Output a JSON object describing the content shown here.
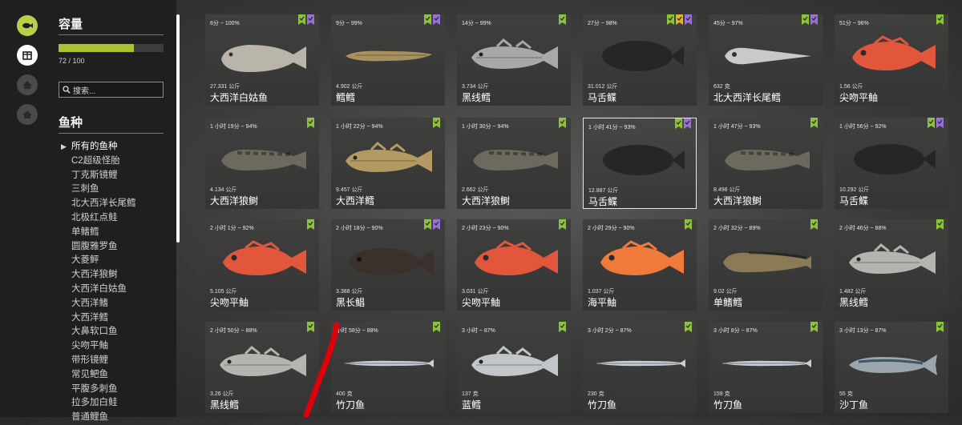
{
  "rail": {
    "icons": [
      "fish-icon",
      "crate-icon",
      "home-icon",
      "home-icon"
    ],
    "accent": "#a9c232"
  },
  "sidebar": {
    "capacity_title": "容量",
    "capacity_value": "72 / 100",
    "capacity_fraction": 0.72,
    "search_placeholder": "搜索...",
    "species_title": "鱼种",
    "species": [
      "所有的鱼种",
      "C2超级怪胎",
      "丁克斯镜鲤",
      "三刺鱼",
      "北大西洋长尾鳕",
      "北极红点鲑",
      "单鳍鳕",
      "圆腹雅罗鱼",
      "大菱鲆",
      "大西洋狼鲥",
      "大西洋白姑鱼",
      "大西洋鳍",
      "大西洋鳕",
      "大鼻软口鱼",
      "尖吻平鲉",
      "带形镜鲤",
      "常见鲃鱼",
      "平腹多刺鱼",
      "拉多加白鲑",
      "普通鲤鱼"
    ]
  },
  "cards": [
    {
      "meta": "6分 ~ 100%",
      "weight": "27.331 公斤",
      "name": "大西洋白姑鱼",
      "badges": [
        "green",
        "purple"
      ],
      "fish": "croaker",
      "color": "#b9b5aa"
    },
    {
      "meta": "9分 ~ 99%",
      "weight": "4.902 公斤",
      "name": "鳕鳕",
      "badges": [
        "green",
        "purple"
      ],
      "fish": "eel",
      "color": "#a8915e"
    },
    {
      "meta": "14分 ~ 99%",
      "weight": "3.734 公斤",
      "name": "黑线鳕",
      "badges": [
        "green"
      ],
      "fish": "cod",
      "color": "#a8a8a6"
    },
    {
      "meta": "27分 ~ 98%",
      "weight": "31.012 公斤",
      "name": "马舌鲽",
      "badges": [
        "green",
        "gold",
        "purple"
      ],
      "fish": "flat",
      "color": "#262626"
    },
    {
      "meta": "45分 ~ 97%",
      "weight": "632 克",
      "name": "北大西洋长尾鳕",
      "badges": [
        "green",
        "purple"
      ],
      "fish": "grenadier",
      "color": "#c9c9cc"
    },
    {
      "meta": "51分 ~ 96%",
      "weight": "1.56 公斤",
      "name": "尖吻平鲉",
      "badges": [
        "green"
      ],
      "fish": "redfish",
      "color": "#e2573b"
    },
    {
      "meta": "1 小时 19分 ~ 94%",
      "weight": "4.134 公斤",
      "name": "大西洋狼鲥",
      "badges": [
        "green"
      ],
      "fish": "wolf",
      "color": "#6c6a5e"
    },
    {
      "meta": "1 小时 22分 ~ 94%",
      "weight": "9.457 公斤",
      "name": "大西洋鳕",
      "badges": [
        "green"
      ],
      "fish": "cod",
      "color": "#b39a62"
    },
    {
      "meta": "1 小时 30分 ~ 94%",
      "weight": "2.662 公斤",
      "name": "大西洋狼鲥",
      "badges": [
        "green"
      ],
      "fish": "wolf",
      "color": "#6c6a5e"
    },
    {
      "meta": "1 小时 41分 ~ 93%",
      "weight": "12.887 公斤",
      "name": "马舌鲽",
      "badges": [
        "green",
        "purple"
      ],
      "fish": "flat",
      "color": "#262626",
      "selected": true
    },
    {
      "meta": "1 小时 47分 ~ 93%",
      "weight": "8.498 公斤",
      "name": "大西洋狼鲥",
      "badges": [
        "green"
      ],
      "fish": "wolf",
      "color": "#6c6a5e"
    },
    {
      "meta": "1 小时 56分 ~ 92%",
      "weight": "10.292 公斤",
      "name": "马舌鲽",
      "badges": [
        "green",
        "purple"
      ],
      "fish": "flat",
      "color": "#262626"
    },
    {
      "meta": "2 小时 1分 ~ 92%",
      "weight": "5.105 公斤",
      "name": "尖吻平鲉",
      "badges": [
        "green"
      ],
      "fish": "redfish",
      "color": "#e2573b"
    },
    {
      "meta": "2 小时 18分 ~ 90%",
      "weight": "3.388 公斤",
      "name": "黑长鲳",
      "badges": [
        "green",
        "purple"
      ],
      "fish": "dark",
      "color": "#3a302c"
    },
    {
      "meta": "2 小时 23分 ~ 90%",
      "weight": "3.031 公斤",
      "name": "尖吻平鲉",
      "badges": [
        "green"
      ],
      "fish": "redfish",
      "color": "#e2573b"
    },
    {
      "meta": "2 小时 29分 ~ 90%",
      "weight": "1.037 公斤",
      "name": "海平鲉",
      "badges": [
        "green"
      ],
      "fish": "redfish",
      "color": "#ef7a3a"
    },
    {
      "meta": "2 小时 32分 ~ 89%",
      "weight": "9.02 公斤",
      "name": "单鳍鳕",
      "badges": [
        "green"
      ],
      "fish": "ling",
      "color": "#8a7a55"
    },
    {
      "meta": "2 小时 46分 ~ 88%",
      "weight": "1.482 公斤",
      "name": "黑线鳕",
      "badges": [
        "green"
      ],
      "fish": "cod",
      "color": "#b5b5b0"
    },
    {
      "meta": "2 小时 50分 ~ 88%",
      "weight": "3.26 公斤",
      "name": "黑线鳕",
      "badges": [
        "green"
      ],
      "fish": "cod",
      "color": "#b5b5b0"
    },
    {
      "meta": "小时 58分 ~ 88%",
      "weight": "400 克",
      "name": "竹刀鱼",
      "badges": [
        "green"
      ],
      "fish": "saury",
      "color": "#c8ced3"
    },
    {
      "meta": "3 小时 ~ 87%",
      "weight": "137 克",
      "name": "蓝鳕",
      "badges": [
        "green"
      ],
      "fish": "cod",
      "color": "#c3c6c9"
    },
    {
      "meta": "3 小时 2分 ~ 87%",
      "weight": "230 克",
      "name": "竹刀鱼",
      "badges": [
        "green"
      ],
      "fish": "saury",
      "color": "#c8ced3"
    },
    {
      "meta": "3 小时 8分 ~ 87%",
      "weight": "159 克",
      "name": "竹刀鱼",
      "badges": [
        "green"
      ],
      "fish": "saury",
      "color": "#c8ced3"
    },
    {
      "meta": "3 小时 13分 ~ 87%",
      "weight": "55 克",
      "name": "沙丁鱼",
      "badges": [
        "green"
      ],
      "fish": "sardine",
      "color": "#9aa6ab"
    }
  ],
  "badge_colors": {
    "green": "#8fc23c",
    "purple": "#9a6fd6",
    "gold": "#e4b21f"
  },
  "annotation": {
    "color": "#e0000a"
  }
}
